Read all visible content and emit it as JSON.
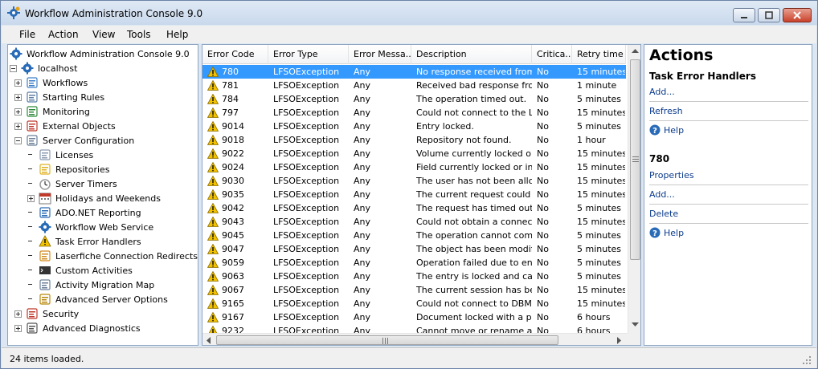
{
  "window": {
    "title": "Workflow Administration Console 9.0"
  },
  "menu": [
    "File",
    "Action",
    "View",
    "Tools",
    "Help"
  ],
  "tree": [
    {
      "label": "Workflow Administration Console 9.0",
      "level": 0,
      "expander": "none",
      "icon": "gear-icon"
    },
    {
      "label": "localhost",
      "level": 0,
      "expander": "minus",
      "icon": "server-gear-icon"
    },
    {
      "label": "Workflows",
      "level": 1,
      "expander": "plus",
      "icon": "workflow-icon"
    },
    {
      "label": "Starting Rules",
      "level": 1,
      "expander": "plus",
      "icon": "rules-icon"
    },
    {
      "label": "Monitoring",
      "level": 1,
      "expander": "plus",
      "icon": "monitor-icon"
    },
    {
      "label": "External Objects",
      "level": 1,
      "expander": "plus",
      "icon": "external-objects-icon"
    },
    {
      "label": "Server Configuration",
      "level": 1,
      "expander": "minus",
      "icon": "server-config-icon"
    },
    {
      "label": "Licenses",
      "level": 2,
      "expander": "none",
      "icon": "license-icon"
    },
    {
      "label": "Repositories",
      "level": 2,
      "expander": "none",
      "icon": "repository-icon"
    },
    {
      "label": "Server Timers",
      "level": 2,
      "expander": "none",
      "icon": "timer-icon"
    },
    {
      "label": "Holidays and Weekends",
      "level": 2,
      "expander": "plus",
      "icon": "calendar-icon"
    },
    {
      "label": "ADO.NET Reporting",
      "level": 2,
      "expander": "none",
      "icon": "report-icon"
    },
    {
      "label": "Workflow Web Service",
      "level": 2,
      "expander": "none",
      "icon": "web-service-icon"
    },
    {
      "label": "Task Error Handlers",
      "level": 2,
      "expander": "none",
      "icon": "warning-icon"
    },
    {
      "label": "Laserfiche Connection Redirects",
      "level": 2,
      "expander": "none",
      "icon": "redirect-icon"
    },
    {
      "label": "Custom Activities",
      "level": 2,
      "expander": "none",
      "icon": "console-icon"
    },
    {
      "label": "Activity Migration Map",
      "level": 2,
      "expander": "none",
      "icon": "migration-icon"
    },
    {
      "label": "Advanced Server Options",
      "level": 2,
      "expander": "none",
      "icon": "options-icon"
    },
    {
      "label": "Security",
      "level": 1,
      "expander": "plus",
      "icon": "security-icon"
    },
    {
      "label": "Advanced Diagnostics",
      "level": 1,
      "expander": "plus",
      "icon": "diagnostics-icon"
    }
  ],
  "grid": {
    "columns": [
      "Error Code",
      "Error Type",
      "Error Messa...",
      "Description",
      "Critica...",
      "Retry time"
    ],
    "rows": [
      {
        "code": "780",
        "type": "LFSOException",
        "msg": "Any",
        "desc": "No response received from...",
        "crit": "No",
        "retry": "15 minutes",
        "selected": true
      },
      {
        "code": "781",
        "type": "LFSOException",
        "msg": "Any",
        "desc": "Received bad response fro...",
        "crit": "No",
        "retry": "1 minute"
      },
      {
        "code": "784",
        "type": "LFSOException",
        "msg": "Any",
        "desc": "The operation timed out.",
        "crit": "No",
        "retry": "5 minutes"
      },
      {
        "code": "797",
        "type": "LFSOException",
        "msg": "Any",
        "desc": "Could not connect to the L...",
        "crit": "No",
        "retry": "15 minutes"
      },
      {
        "code": "9014",
        "type": "LFSOException",
        "msg": "Any",
        "desc": "Entry locked.",
        "crit": "No",
        "retry": "5 minutes"
      },
      {
        "code": "9018",
        "type": "LFSOException",
        "msg": "Any",
        "desc": "Repository not found.",
        "crit": "No",
        "retry": "1 hour"
      },
      {
        "code": "9022",
        "type": "LFSOException",
        "msg": "Any",
        "desc": "Volume currently locked or ...",
        "crit": "No",
        "retry": "15 minutes"
      },
      {
        "code": "9024",
        "type": "LFSOException",
        "msg": "Any",
        "desc": "Field currently locked or in ...",
        "crit": "No",
        "retry": "15 minutes"
      },
      {
        "code": "9030",
        "type": "LFSOException",
        "msg": "Any",
        "desc": "The user has not been allo...",
        "crit": "No",
        "retry": "15 minutes"
      },
      {
        "code": "9035",
        "type": "LFSOException",
        "msg": "Any",
        "desc": "The current request could ...",
        "crit": "No",
        "retry": "15 minutes"
      },
      {
        "code": "9042",
        "type": "LFSOException",
        "msg": "Any",
        "desc": "The request has timed out.",
        "crit": "No",
        "retry": "5 minutes"
      },
      {
        "code": "9043",
        "type": "LFSOException",
        "msg": "Any",
        "desc": "Could not obtain a connect...",
        "crit": "No",
        "retry": "15 minutes"
      },
      {
        "code": "9045",
        "type": "LFSOException",
        "msg": "Any",
        "desc": "The operation cannot com...",
        "crit": "No",
        "retry": "5 minutes"
      },
      {
        "code": "9047",
        "type": "LFSOException",
        "msg": "Any",
        "desc": "The object has been modifi...",
        "crit": "No",
        "retry": "5 minutes"
      },
      {
        "code": "9059",
        "type": "LFSOException",
        "msg": "Any",
        "desc": "Operation failed due to entr...",
        "crit": "No",
        "retry": "5 minutes"
      },
      {
        "code": "9063",
        "type": "LFSOException",
        "msg": "Any",
        "desc": "The entry is locked and ca...",
        "crit": "No",
        "retry": "5 minutes"
      },
      {
        "code": "9067",
        "type": "LFSOException",
        "msg": "Any",
        "desc": "The current session has be...",
        "crit": "No",
        "retry": "15 minutes"
      },
      {
        "code": "9165",
        "type": "LFSOException",
        "msg": "Any",
        "desc": "Could not connect to DBM...",
        "crit": "No",
        "retry": "15 minutes"
      },
      {
        "code": "9167",
        "type": "LFSOException",
        "msg": "Any",
        "desc": "Document locked with a p...",
        "crit": "No",
        "retry": "6 hours"
      },
      {
        "code": "9232",
        "type": "LFSOException",
        "msg": "Any",
        "desc": "Cannot move or rename a...",
        "crit": "No",
        "retry": "6 hours"
      }
    ]
  },
  "actions": {
    "title": "Actions",
    "section1": "Task Error Handlers",
    "add": "Add...",
    "refresh": "Refresh",
    "help": "Help",
    "section2": "780",
    "properties": "Properties",
    "add2": "Add...",
    "delete": "Delete",
    "help2": "Help"
  },
  "status": {
    "text": "24 items loaded."
  },
  "colors": {
    "selection": "#3399ff",
    "link": "#0a3a8c",
    "warning": "#f2c200"
  }
}
